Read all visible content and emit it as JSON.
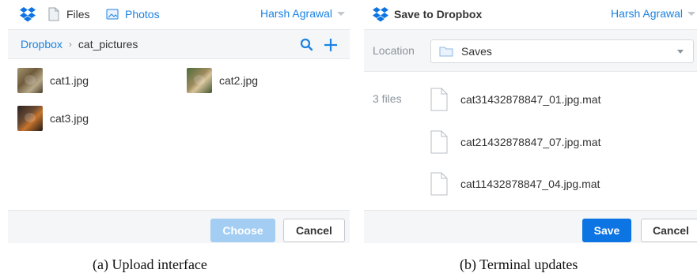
{
  "upload": {
    "tabs": [
      {
        "label": "Files",
        "icon": "file-icon"
      },
      {
        "label": "Photos",
        "icon": "photos-icon"
      }
    ],
    "user": "Harsh Agrawal",
    "breadcrumb": {
      "root": "Dropbox",
      "separator": "›",
      "current": "cat_pictures"
    },
    "files": [
      {
        "name": "cat1.jpg"
      },
      {
        "name": "cat2.jpg"
      },
      {
        "name": "cat3.jpg"
      }
    ],
    "buttons": {
      "choose": "Choose",
      "cancel": "Cancel"
    },
    "colors": {
      "accent": "#1a82e2",
      "choose_disabled": "#a4cdf3"
    }
  },
  "save": {
    "title": "Save to Dropbox",
    "user": "Harsh Agrawal",
    "location_label": "Location",
    "location_value": "Saves",
    "files_count": "3 files",
    "files": [
      {
        "name": "cat31432878847_01.jpg.mat"
      },
      {
        "name": "cat21432878847_07.jpg.mat"
      },
      {
        "name": "cat11432878847_04.jpg.mat"
      }
    ],
    "buttons": {
      "save": "Save",
      "cancel": "Cancel"
    },
    "colors": {
      "save": "#0d74e3"
    }
  },
  "captions": {
    "a": "(a) Upload interface",
    "b": "(b) Terminal updates"
  }
}
